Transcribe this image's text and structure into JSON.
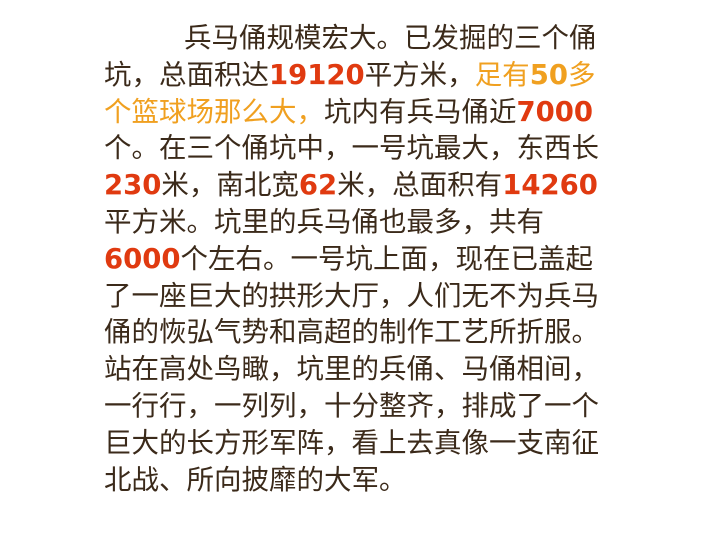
{
  "lines": [
    [
      {
        "t": "兵马俑规模宏大。已发掘的三个俑",
        "s": "plain"
      }
    ],
    [
      {
        "t": "坑，总面积达",
        "s": "plain"
      },
      {
        "t": "19120",
        "s": "num"
      },
      {
        "t": "平方米，",
        "s": "plain"
      },
      {
        "t": "足有",
        "s": "hl"
      },
      {
        "t": "50",
        "s": "hlb"
      },
      {
        "t": "多",
        "s": "hl"
      }
    ],
    [
      {
        "t": "个篮球场那么大，",
        "s": "hl"
      },
      {
        "t": "坑内有兵马俑近",
        "s": "plain"
      },
      {
        "t": "7000",
        "s": "num"
      }
    ],
    [
      {
        "t": "个。在三个俑坑中，一号坑最大，东西长",
        "s": "plain"
      }
    ],
    [
      {
        "t": "230",
        "s": "num"
      },
      {
        "t": "米，南北宽",
        "s": "plain"
      },
      {
        "t": "62",
        "s": "num"
      },
      {
        "t": "米，总面积有",
        "s": "plain"
      },
      {
        "t": "14260",
        "s": "num"
      }
    ],
    [
      {
        "t": "平方米。坑里的兵马俑也最多，共有",
        "s": "plain"
      }
    ],
    [
      {
        "t": "6000",
        "s": "num"
      },
      {
        "t": "个左右。一号坑上面，现在已盖起",
        "s": "plain"
      }
    ],
    [
      {
        "t": "了一座巨大的拱形大厅，人们无不为兵马",
        "s": "plain"
      }
    ],
    [
      {
        "t": "俑的恢弘气势和高超的制作工艺所折服。",
        "s": "plain"
      }
    ],
    [
      {
        "t": "站在高处鸟瞰，坑里的兵俑、马俑相间，",
        "s": "plain"
      }
    ],
    [
      {
        "t": "一行行，一列列，十分整齐，排成了一个",
        "s": "plain"
      }
    ],
    [
      {
        "t": "巨大的长方形军阵，看上去真像一支南征",
        "s": "plain"
      }
    ],
    [
      {
        "t": "北战、所向披靡的大军。",
        "s": "plain"
      }
    ]
  ],
  "colors": {
    "text": "#3b2a1a",
    "number": "#e03a10",
    "highlight": "#f0a020",
    "background": "#ffffff"
  }
}
